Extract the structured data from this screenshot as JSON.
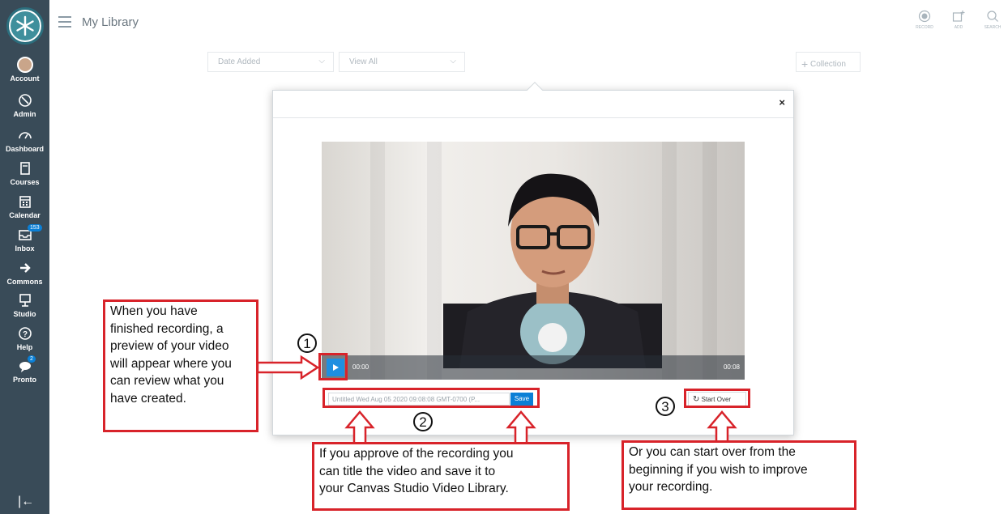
{
  "sidebar": {
    "items": [
      {
        "label": "Account",
        "icon": "avatar"
      },
      {
        "label": "Admin",
        "icon": "shield-icon"
      },
      {
        "label": "Dashboard",
        "icon": "dashboard-icon"
      },
      {
        "label": "Courses",
        "icon": "book-icon"
      },
      {
        "label": "Calendar",
        "icon": "calendar-icon"
      },
      {
        "label": "Inbox",
        "icon": "inbox-icon",
        "badge": "153"
      },
      {
        "label": "Commons",
        "icon": "commons-icon"
      },
      {
        "label": "Studio",
        "icon": "studio-icon"
      },
      {
        "label": "Help",
        "icon": "help-icon"
      },
      {
        "label": "Pronto",
        "icon": "chat-icon",
        "badge": "2"
      }
    ]
  },
  "header": {
    "title": "My Library",
    "actions": [
      {
        "label": "RECORD",
        "icon": "record-icon"
      },
      {
        "label": "ADD",
        "icon": "add-media-icon"
      },
      {
        "label": "SEARCH",
        "icon": "search-icon"
      }
    ]
  },
  "filters": {
    "sort": "Date Added",
    "view": "View All",
    "collection": "Collection"
  },
  "modal": {
    "close": "×",
    "time_current": "00:00",
    "time_total": "00:08",
    "title_value": "Untitled Wed Aug 05 2020 09:08:08 GMT-0700 (P...",
    "save_label": "Save",
    "start_over_label": "Start Over"
  },
  "annotations": {
    "n1": "1",
    "n2": "2",
    "n3": "3",
    "note1_lines": [
      "When you have",
      "finished recording, a",
      "preview of your video",
      "will appear where you",
      "can review what you",
      "have created."
    ],
    "note2_lines": [
      "If you approve of the recording you",
      "can title the video and save it to",
      "your Canvas Studio Video Library."
    ],
    "note3_lines": [
      "Or you can start over from the",
      "beginning if you wish to improve",
      "your recording."
    ],
    "accent": "#d8232a"
  }
}
